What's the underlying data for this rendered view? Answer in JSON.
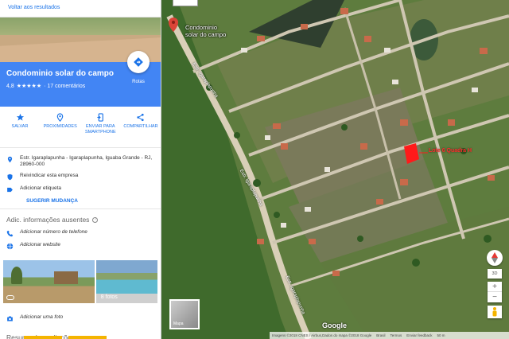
{
  "panel": {
    "back_link": "Voltar aos resultados",
    "place_name": "Condominio solar do campo",
    "rating": "4,8",
    "stars": "★★★★★",
    "reviews": "· 17 comentários",
    "route_label": "Rotas",
    "actions": [
      {
        "label": "SALVAR",
        "icon": "star-icon"
      },
      {
        "label": "PROXIMIDADES",
        "icon": "nearby-icon"
      },
      {
        "label": "ENVIAR PARA SMARTPHONE",
        "icon": "send-to-phone-icon"
      },
      {
        "label": "COMPARTILHAR",
        "icon": "share-icon"
      }
    ],
    "address": "Estr. Igaraplapunha - Igaraplapunha, Iguaba Grande - RJ, 28960-000",
    "claim": "Reivindicar esta empresa",
    "add_label": "Adicionar etiqueta",
    "suggest": "SUGERIR MUDANÇA",
    "missing_title": "Adic. informações ausentes",
    "add_phone": "Adicionar número de telefone",
    "add_website": "Adicionar website",
    "photo_count": "8 fotos",
    "add_photo": "Adicionar uma foto",
    "reviews_title": "Resumo de avaliações",
    "accent": "#4285f4",
    "link_color": "#1a73e8"
  },
  "map": {
    "pin_label_line1": "Condominio",
    "pin_label_line2": "solar do campo",
    "lote_label": "Lote 6 Quadra H",
    "road_label_1": "Estr. Igaraplapunha",
    "road_label_2": "Estr. Igaraplapunha",
    "road_label_3": "Estr. Igaraplapunha",
    "minimap_label": "Mapa",
    "google": "Google",
    "footer_imagery": "Imagens ©2018 CNES / Airbus,Dados do mapa ©2018 Google",
    "footer_country": "Brasil",
    "footer_terms": "Termos",
    "footer_feedback": "Enviar feedback",
    "footer_scale": "50 m",
    "btn_3d": "3D",
    "zoom_in": "+",
    "zoom_out": "−"
  }
}
